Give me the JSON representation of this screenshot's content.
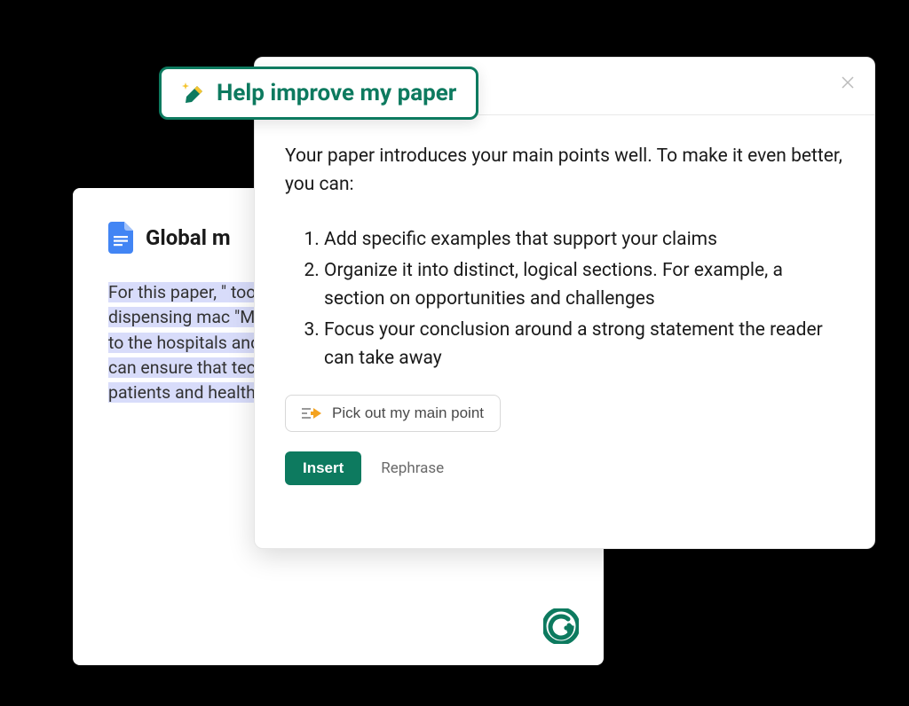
{
  "document": {
    "title": "Global m",
    "body": "For this paper, \" tools and system tracking invento dispensing mac \"Medicine distril the logistics of g patients, to the hospitals and ph the opportunitie use of technolog can ensure that technology is used in a way that benefits patients and healthcare providers alike."
  },
  "titleTab": {
    "label": "Help improve my paper"
  },
  "panel": {
    "intro": "Your paper introduces your main points well. To make it even better, you can:",
    "suggestions": [
      "Add specific examples that support your claims",
      "Organize it into distinct, logical sections. For example, a section on opportunities and challenges",
      "Focus your conclusion around a strong statement the reader can take away"
    ],
    "pickButton": "Pick out my main point",
    "insertButton": "Insert",
    "rephraseLink": "Rephrase"
  }
}
